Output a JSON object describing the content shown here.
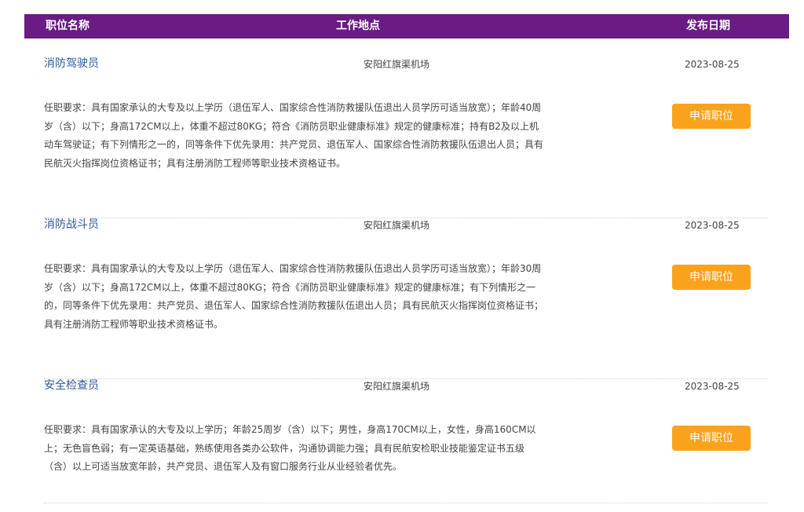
{
  "header": {
    "title_col": "职位名称",
    "location_col": "工作地点",
    "date_col": "发布日期"
  },
  "jobs": [
    {
      "title": "消防驾驶员",
      "location": "安阳红旗渠机场",
      "date": "2023-08-25",
      "requirement": "任职要求：具有国家承认的大专及以上学历（退伍军人、国家综合性消防救援队伍退出人员学历可适当放宽）；年龄40周岁（含）以下；身高172CM以上，体重不超过80KG；符合《消防员职业健康标准》规定的健康标准；持有B2及以上机动车驾驶证；有下列情形之一的，同等条件下优先录用：共产党员、退伍军人、国家综合性消防救援队伍退出人员；具有民航灭火指挥岗位资格证书；具有注册消防工程师等职业技术资格证书。",
      "apply": "申请职位"
    },
    {
      "title": "消防战斗员",
      "location": "安阳红旗渠机场",
      "date": "2023-08-25",
      "requirement": "任职要求：具有国家承认的大专及以上学历（退伍军人、国家综合性消防救援队伍退出人员学历可适当放宽）；年龄30周岁（含）以下；身高172CM以上，体重不超过80KG；符合《消防员职业健康标准》规定的健康标准；有下列情形之一的，同等条件下优先录用：共产党员、退伍军人、国家综合性消防救援队伍退出人员；具有民航灭火指挥岗位资格证书；具有注册消防工程师等职业技术资格证书。",
      "apply": "申请职位"
    },
    {
      "title": "安全检查员",
      "location": "安阳红旗渠机场",
      "date": "2023-08-25",
      "requirement": "任职要求：具有国家承认的大专及以上学历；年龄25周岁（含）以下；男性，身高170CM以上，女性，身高160CM以上；无色盲色弱；有一定英语基础，熟练使用各类办公软件，沟通协调能力强；具有民航安检职业技能鉴定证书五级（含）以上可适当放宽年龄，共产党员、退伍军人及有窗口服务行业从业经验者优先。",
      "apply": "申请职位"
    }
  ]
}
